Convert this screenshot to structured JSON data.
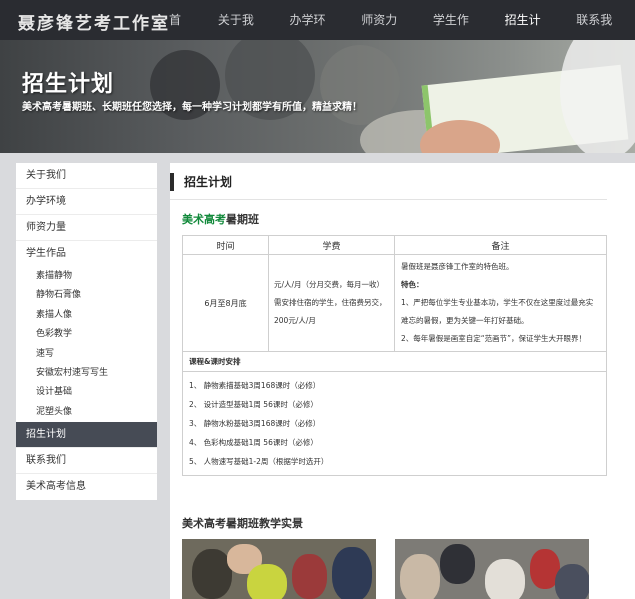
{
  "header": {
    "logo": "聂彦锋艺考工作室",
    "nav": [
      "首页",
      "关于我们",
      "办学环境",
      "师资力量",
      "学生作品",
      "招生计划",
      "联系我们"
    ]
  },
  "banner": {
    "title": "招生计划",
    "subtitle": "美术高考暑期班、长期班任您选择，每一种学习计划都学有所值，精益求精！"
  },
  "sidebar": {
    "items": [
      "关于我们",
      "办学环境",
      "师资力量",
      "学生作品"
    ],
    "sub_items": [
      "素描静物",
      "静物石膏像",
      "素描人像",
      "色彩教学",
      "速写",
      "安徽宏村速写写生",
      "设计基础",
      "泥塑头像"
    ],
    "after": [
      "招生计划",
      "联系我们",
      "美术高考信息"
    ]
  },
  "main": {
    "title": "招生计划",
    "section1_green": "美术高考",
    "section1_rest": "暑期班",
    "table": {
      "headers": [
        "时间",
        "学费",
        "备注"
      ],
      "time": "6月至8月底",
      "fee": [
        "元/人/月（分月交费，每月一收）",
        "需安排住宿的学生，住宿费另交，",
        "200元/人/月"
      ],
      "note_intro": "暑假班是聂彦锋工作室的特色班。",
      "note_label": "特色：",
      "note_1": "1、严把每位学生专业基本功，学生不仅在这里度过最充实难忘的暑假，更为关键一年打好基础。",
      "note_2": "2、每年暑假是画室自定“范画节”，保证学生大开眼界！",
      "course_head": "课程&课时安排",
      "courses": [
        "1、 静物素描基础3周168课时（必修）",
        "2、 设计造型基础1周 56课时（必修）",
        "3、 静物水粉基础3周168课时（必修）",
        "4、 色彩构成基础1周 56课时（必修）",
        "5、 人物速写基础1-2周（根据学时选开）"
      ]
    },
    "section2": "美术高考暑期班教学实景"
  }
}
